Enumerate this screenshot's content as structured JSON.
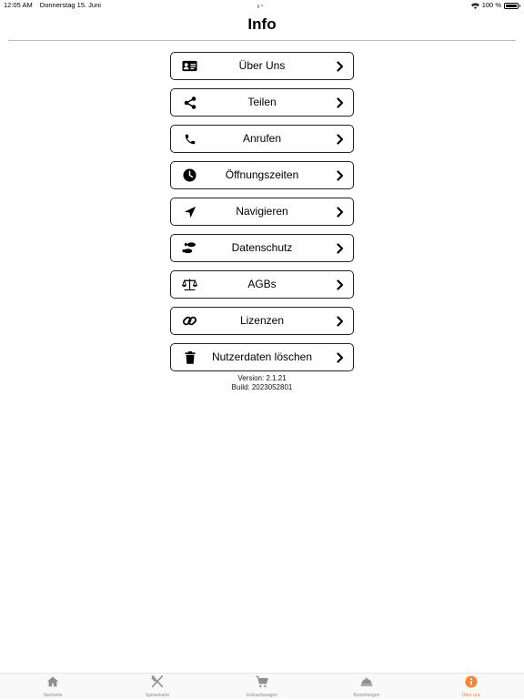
{
  "status": {
    "time": "12:05 AM",
    "date": "Donnerstag 15. Juni",
    "battery": "100 %"
  },
  "header": {
    "title": "Info"
  },
  "menu": {
    "items": [
      {
        "label": "Über Uns",
        "icon": "contact-card-icon"
      },
      {
        "label": "Teilen",
        "icon": "share-icon"
      },
      {
        "label": "Anrufen",
        "icon": "phone-icon"
      },
      {
        "label": "Öffnungszeiten",
        "icon": "clock-icon"
      },
      {
        "label": "Navigieren",
        "icon": "location-arrow-icon"
      },
      {
        "label": "Datenschutz",
        "icon": "footprints-icon"
      },
      {
        "label": "AGBs",
        "icon": "balance-scale-icon"
      },
      {
        "label": "Lizenzen",
        "icon": "link-icon"
      },
      {
        "label": "Nutzerdaten löschen",
        "icon": "trash-icon"
      }
    ]
  },
  "version": {
    "version_line": "Version: 2.1.21",
    "build_line": "Build: 2023052801"
  },
  "tabbar": {
    "tabs": [
      {
        "label": "Startseite",
        "icon": "home-icon"
      },
      {
        "label": "Speisekarte",
        "icon": "fork-knife-icon"
      },
      {
        "label": "Einkaufswagen",
        "icon": "cart-icon"
      },
      {
        "label": "Bestellungen",
        "icon": "cloche-icon"
      },
      {
        "label": "Über uns",
        "icon": "info-icon"
      }
    ],
    "active_index": 4
  },
  "colors": {
    "accent": "#f0883e",
    "inactive": "#8e8e93",
    "border": "#222222"
  }
}
